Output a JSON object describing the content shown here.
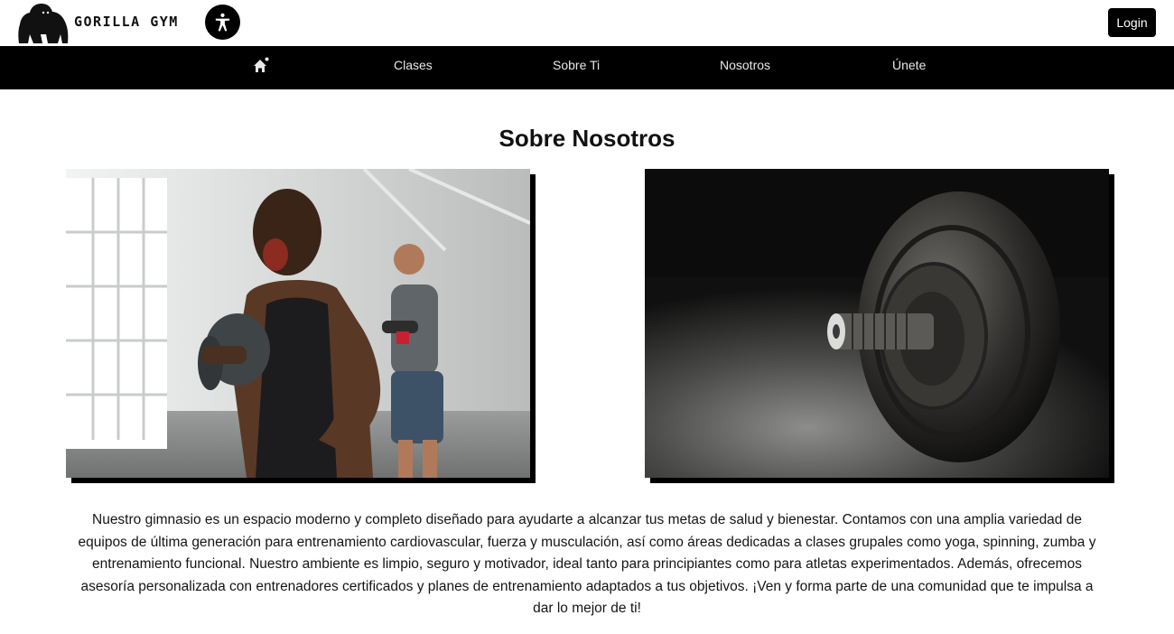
{
  "header": {
    "brand_name": "GORILLA GYM",
    "logo_icon": "gorilla-logo",
    "accessibility_icon": "accessibility-icon",
    "login_label": "Login"
  },
  "nav": {
    "home_icon": "home-icon",
    "items": [
      {
        "label": "Clases"
      },
      {
        "label": "Sobre Ti"
      },
      {
        "label": "Nosotros"
      },
      {
        "label": "Únete"
      }
    ]
  },
  "main": {
    "title": "Sobre Nosotros",
    "description": "Nuestro gimnasio es un espacio moderno y completo diseñado para ayudarte a alcanzar tus metas de salud y bienestar. Contamos con una amplia variedad de equipos de última generación para entrenamiento cardiovascular, fuerza y musculación, así como áreas dedicadas a clases grupales como yoga, spinning, zumba y entrenamiento funcional. Nuestro ambiente es limpio, seguro y motivador, ideal tanto para principiantes como para atletas experimentados. Además, ofrecemos asesoría personalizada con entrenadores certificados y planes de entrenamiento adaptados a tus objetivos. ¡Ven y forma parte de una comunidad que te impulsa a dar lo mejor de ti!"
  },
  "colors": {
    "nav_background": "#000000",
    "button_background": "#000000",
    "page_background": "#ffffff"
  }
}
